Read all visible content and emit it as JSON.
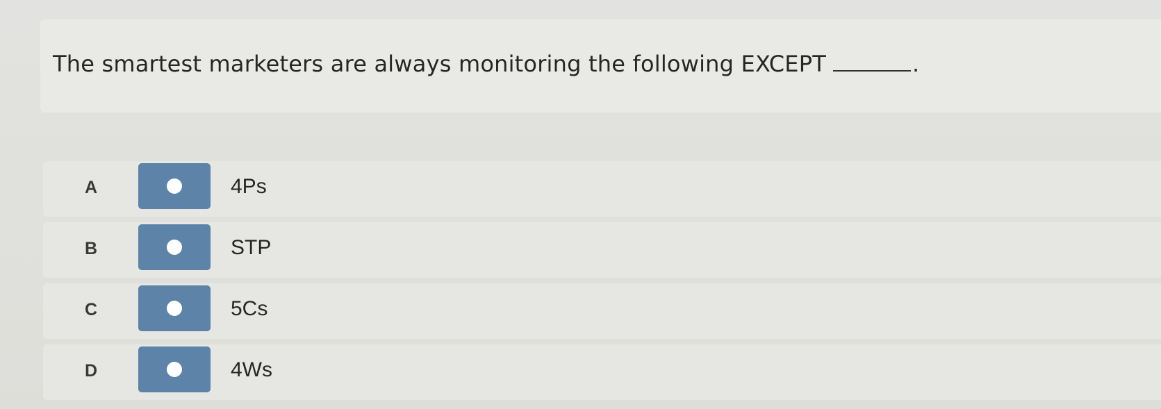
{
  "question": {
    "text": "The smartest marketers are always monitoring the following EXCEPT",
    "terminal_punctuation": "."
  },
  "options": [
    {
      "letter": "A",
      "label": "4Ps"
    },
    {
      "letter": "B",
      "label": "STP"
    },
    {
      "letter": "C",
      "label": "5Cs"
    },
    {
      "letter": "D",
      "label": "4Ws"
    }
  ],
  "colors": {
    "radio_fill": "#5d83a8",
    "radio_dot": "#ffffff",
    "card_background": "#e9e9e6",
    "page_background": "#dcdcda"
  }
}
